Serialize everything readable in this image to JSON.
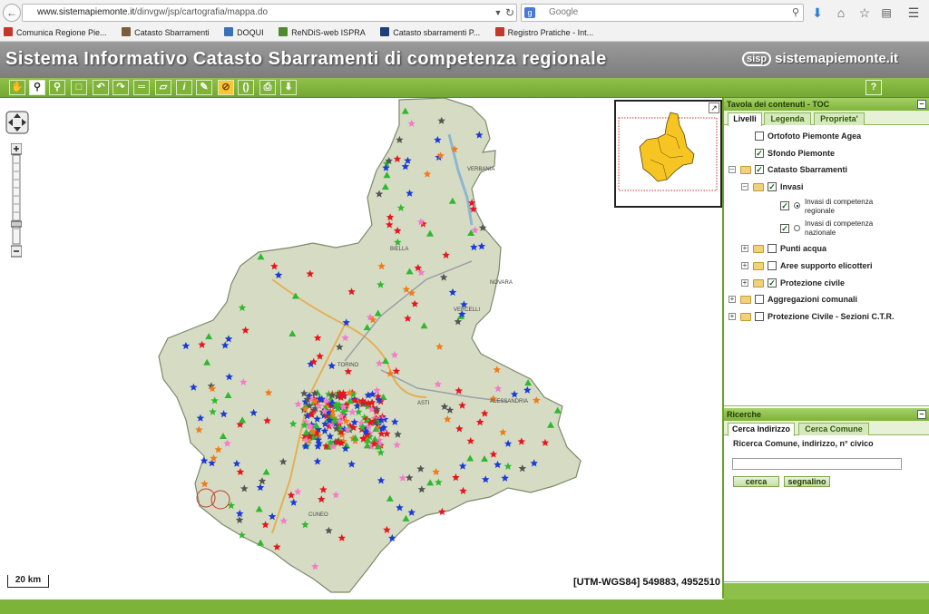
{
  "browser": {
    "url_domain": "www.sistemapiemonte.it",
    "url_path": "/dinvgw/jsp/cartografia/mappa.do",
    "search_engine": "Google",
    "bookmarks": [
      {
        "label": "Comunica Regione Pie...",
        "color": "#c0392b"
      },
      {
        "label": "Catasto Sbarramenti",
        "color": "#7a5c3a"
      },
      {
        "label": "DOQUI",
        "color": "#3b6fb6"
      },
      {
        "label": "ReNDiS-web ISPRA",
        "color": "#4e8a2f"
      },
      {
        "label": "Catasto sbarramenti P...",
        "color": "#1d3f7a"
      },
      {
        "label": "Registro Pratiche - Int...",
        "color": "#c0392b"
      }
    ]
  },
  "header": {
    "title": "Sistema Informativo Catasto Sbarramenti di competenza regionale",
    "logo_badge": "sisp",
    "logo_text": "sistemapiemonte.it"
  },
  "toolbar": {
    "tools": [
      "pan-tool-icon",
      "zoom-in-tool-icon",
      "zoom-out-tool-icon",
      "zoom-box-tool-icon",
      "previous-view-icon",
      "next-view-icon",
      "measure-distance-icon",
      "measure-area-icon",
      "info-icon",
      "select-icon",
      "clear-icon",
      "refresh-icon",
      "print-icon",
      "download-icon"
    ],
    "help_label": "?"
  },
  "map": {
    "scale_label": "20 km",
    "coords_label": "[UTM-WGS84] 549883, 4952510",
    "places": [
      "VERBANIA",
      "BIELLA",
      "NOVARA",
      "VERCELLI",
      "TORINO",
      "ASTI",
      "ALESSANDRIA",
      "CUNEO"
    ],
    "colors": {
      "region": "#d6dcc4",
      "marker_red": "#e8141e",
      "marker_blue": "#1a3bd6",
      "marker_green": "#2fb82f",
      "marker_gray": "#555555",
      "marker_pink": "#f47acb",
      "overview_fill": "#f7c523"
    }
  },
  "toc": {
    "title": "Tavola dei contenuti - TOC",
    "tabs": [
      "Livelli",
      "Legenda",
      "Proprieta'"
    ],
    "layers": {
      "ortofoto": "Ortofoto Piemonte Agea",
      "sfondo": "Sfondo Piemonte",
      "catasto": "Catasto Sbarramenti",
      "invasi": "Invasi",
      "invasi_regionale": "Invasi di competenza regionale",
      "invasi_nazionale": "Invasi di competenza nazionale",
      "punti_acqua": "Punti acqua",
      "aree_elicotteri": "Aree supporto elicotteri",
      "protezione_civile": "Protezione civile",
      "aggregazioni": "Aggregazioni comunali",
      "sezioni_ctr": "Protezione Civile - Sezioni C.T.R."
    }
  },
  "search": {
    "title": "Ricerche",
    "tabs": [
      "Cerca Indirizzo",
      "Cerca Comune"
    ],
    "label": "Ricerca Comune, indirizzo, n° civico",
    "input_value": "",
    "search_button": "cerca",
    "report_button": "segnalino"
  }
}
